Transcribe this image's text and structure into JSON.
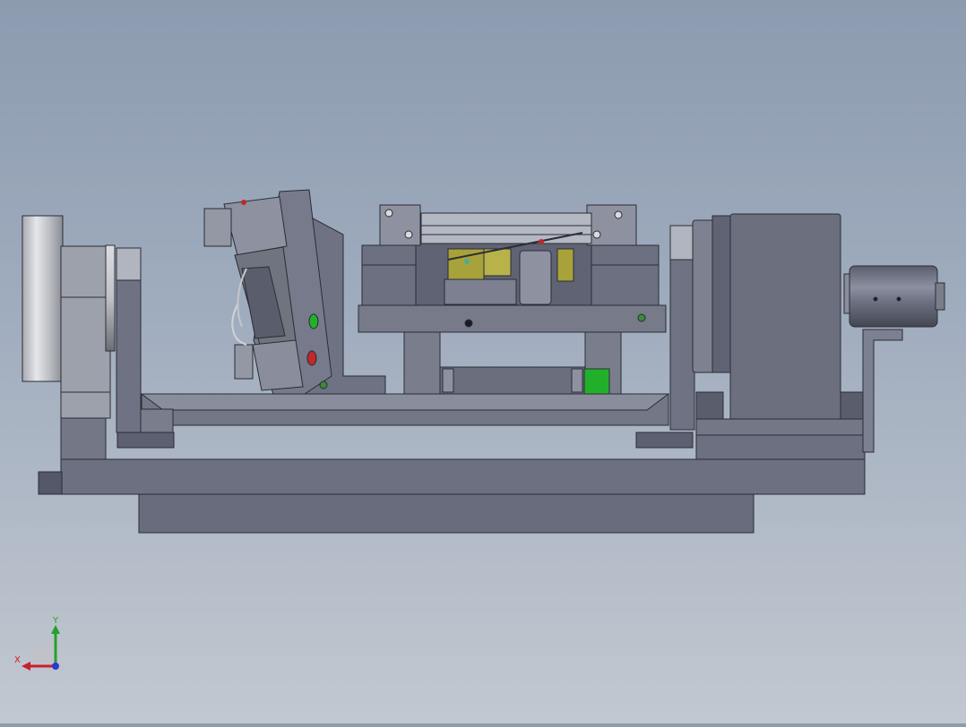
{
  "viewport": {
    "title": "",
    "background_top": "#8d9bb0",
    "background_bottom": "#c2c8d0"
  },
  "model": {
    "name": "",
    "body_color": "#6c7080",
    "edge_color": "#2a2d36",
    "highlight_color": "#9aa0ae",
    "accent_yellow": "#a8a23a",
    "accent_green": "#22b02a",
    "accent_red": "#c0282a"
  },
  "triad": {
    "x_label": "X",
    "y_label": "Y",
    "x_color": "#c8202a",
    "y_color": "#22a02a",
    "z_color": "#2a3ad0"
  }
}
